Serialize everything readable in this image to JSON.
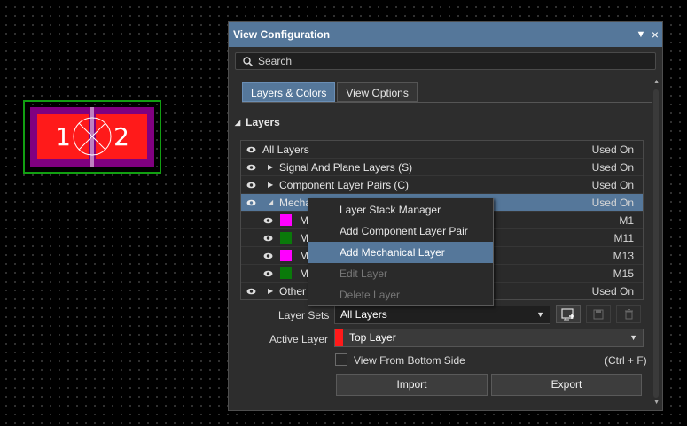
{
  "footprint": {
    "pad1_label": "1",
    "pad2_label": "2",
    "colors": {
      "outline": "#12a012",
      "pad": "#ff1a1a",
      "body": "#800080"
    }
  },
  "panel": {
    "title": "View Configuration",
    "title_buttons": {
      "pin": "▼",
      "close": "×"
    },
    "search": {
      "placeholder": "Search"
    },
    "tabs": [
      {
        "label": "Layers & Colors",
        "active": true
      },
      {
        "label": "View Options",
        "active": false
      }
    ],
    "section_title": "Layers",
    "layers": {
      "header": {
        "name": "All Layers",
        "status": "Used On"
      },
      "rows": [
        {
          "name": "Signal And Plane Layers (S)",
          "status": "Used On"
        },
        {
          "name": "Component Layer Pairs (C)",
          "status": "Used On"
        },
        {
          "name": "Mecha",
          "status": "Used On",
          "selected": true
        },
        {
          "name": "M",
          "status": "M1",
          "color": "#ff00ff"
        },
        {
          "name": "M",
          "status": "M11",
          "color": "#0a7a0a"
        },
        {
          "name": "M",
          "status": "M13",
          "color": "#ff00ff"
        },
        {
          "name": "M",
          "status": "M15",
          "color": "#0a7a0a"
        },
        {
          "name": "Other",
          "status": "Used On"
        }
      ]
    },
    "layer_sets": {
      "label": "Layer Sets",
      "value": "All Layers"
    },
    "active_layer": {
      "label": "Active Layer",
      "value": "Top Layer",
      "color": "#ff1a1a"
    },
    "view_from_bottom": {
      "label": "View From Bottom Side",
      "shortcut": "(Ctrl + F)",
      "checked": false
    },
    "buttons": {
      "import": "Import",
      "export": "Export"
    }
  },
  "context_menu": {
    "items": [
      {
        "label": "Layer Stack Manager",
        "state": "normal"
      },
      {
        "label": "Add Component Layer Pair",
        "state": "normal"
      },
      {
        "label": "Add Mechanical Layer",
        "state": "highlighted"
      },
      {
        "label": "Edit Layer",
        "state": "disabled"
      },
      {
        "label": "Delete Layer",
        "state": "disabled"
      }
    ]
  },
  "colors": {
    "accent": "#55779a",
    "panel_bg": "#2d2d2d",
    "canvas_bg": "#000000"
  }
}
